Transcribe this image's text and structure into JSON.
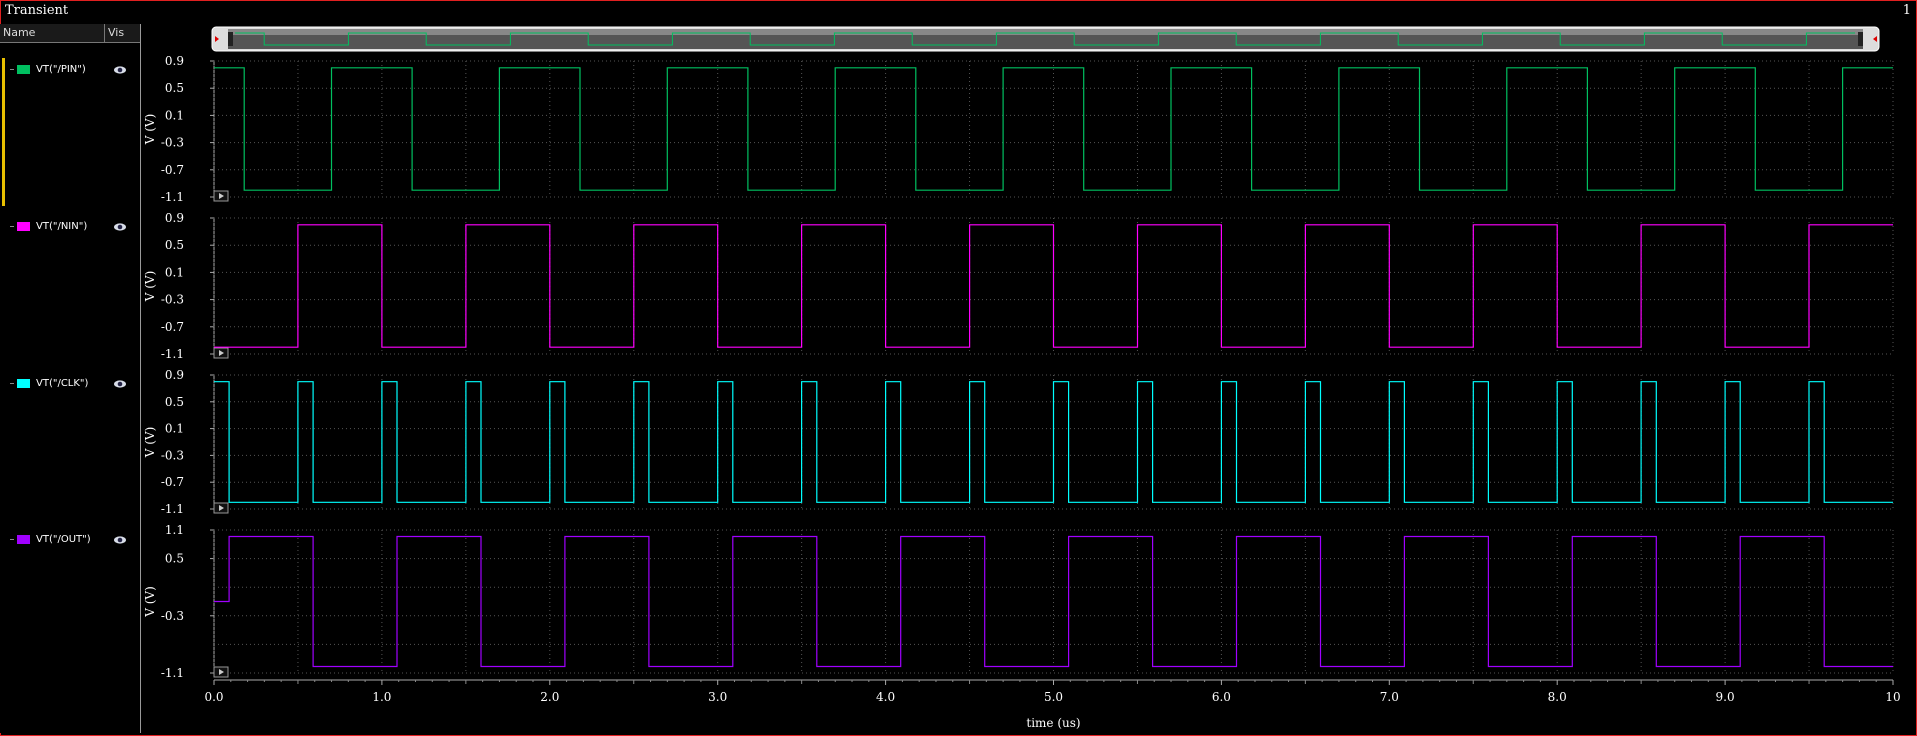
{
  "window": {
    "title": "Transient",
    "page_number": "1"
  },
  "sidebar": {
    "header_name": "Name",
    "header_vis": "Vis",
    "items": [
      {
        "label": "VT(\"/PIN\")",
        "color": "#00c060"
      },
      {
        "label": "VT(\"/NIN\")",
        "color": "#ff00ff"
      },
      {
        "label": "VT(\"/CLK\")",
        "color": "#00ffff"
      },
      {
        "label": "VT(\"/OUT\")",
        "color": "#a000ff"
      }
    ]
  },
  "colors": {
    "background": "#000000",
    "grid": "#555555",
    "frame": "#e02020",
    "axis_text": "#ffffff"
  },
  "chart_data": {
    "type": "line",
    "xlabel": "time (us)",
    "xlim": [
      0,
      10
    ],
    "xticks": [
      "0.0",
      "1.0",
      "2.0",
      "3.0",
      "4.0",
      "5.0",
      "6.0",
      "7.0",
      "8.0",
      "9.0",
      "10"
    ],
    "panels": [
      {
        "name": "VT(\"/PIN\")",
        "color": "#00c060",
        "ylabel": "V (V)",
        "ylim": [
          -1.1,
          0.9
        ],
        "yticks": [
          "0.9",
          "0.5",
          "0.1",
          "-0.3",
          "-0.7",
          "-1.1"
        ],
        "series": [
          {
            "name": "VT(\"/PIN\")",
            "high": 0.8,
            "low": -1.0,
            "initial": "high",
            "edges": [
              0.18,
              0.7,
              1.18,
              1.7,
              2.18,
              2.7,
              3.18,
              3.7,
              4.18,
              4.7,
              5.18,
              5.7,
              6.18,
              6.7,
              7.18,
              7.7,
              8.18,
              8.7,
              9.18,
              9.7
            ]
          }
        ]
      },
      {
        "name": "VT(\"/NIN\")",
        "color": "#ff00ff",
        "ylabel": "V (V)",
        "ylim": [
          -1.1,
          0.9
        ],
        "yticks": [
          "0.9",
          "0.5",
          "0.1",
          "-0.3",
          "-0.7",
          "-1.1"
        ],
        "series": [
          {
            "name": "VT(\"/NIN\")",
            "high": 0.8,
            "low": -1.0,
            "initial": "low",
            "edges": [
              0.5,
              1.0,
              1.5,
              2.0,
              2.5,
              3.0,
              3.5,
              4.0,
              4.5,
              5.0,
              5.5,
              6.0,
              6.5,
              7.0,
              7.5,
              8.0,
              8.5,
              9.0,
              9.5
            ]
          }
        ]
      },
      {
        "name": "VT(\"/CLK\")",
        "color": "#00ffff",
        "ylabel": "V (V)",
        "ylim": [
          -1.1,
          0.9
        ],
        "yticks": [
          "0.9",
          "0.5",
          "0.1",
          "-0.3",
          "-0.7",
          "-1.1"
        ],
        "series": [
          {
            "name": "VT(\"/CLK\")",
            "high": 0.8,
            "low": -1.0,
            "initial": "high",
            "edges": [
              0.09,
              0.5,
              0.59,
              1.0,
              1.09,
              1.5,
              1.59,
              2.0,
              2.09,
              2.5,
              2.59,
              3.0,
              3.09,
              3.5,
              3.59,
              4.0,
              4.09,
              4.5,
              4.59,
              5.0,
              5.09,
              5.5,
              5.59,
              6.0,
              6.09,
              6.5,
              6.59,
              7.0,
              7.09,
              7.5,
              7.59,
              8.0,
              8.09,
              8.5,
              8.59,
              9.0,
              9.09,
              9.5,
              9.59
            ]
          }
        ]
      },
      {
        "name": "VT(\"/OUT\")",
        "color": "#a000ff",
        "ylabel": "V (V)",
        "ylim": [
          -1.1,
          1.1
        ],
        "yticks": [
          "1.1",
          "0.5",
          "",
          "-0.3",
          "",
          "-1.1"
        ],
        "series": [
          {
            "name": "VT(\"/OUT\")",
            "high": 1.0,
            "low": -1.0,
            "initial": "mid",
            "initial_value": 0.0,
            "edges": [
              0.09,
              0.59,
              1.09,
              1.59,
              2.09,
              2.59,
              3.09,
              3.59,
              4.09,
              4.59,
              5.09,
              5.59,
              6.09,
              6.59,
              7.09,
              7.59,
              8.09,
              8.59,
              9.09,
              9.59
            ],
            "first_edge_target": "high"
          }
        ]
      }
    ],
    "overview": {
      "series": "VT(\"/PIN\")",
      "color": "#00c060"
    }
  }
}
